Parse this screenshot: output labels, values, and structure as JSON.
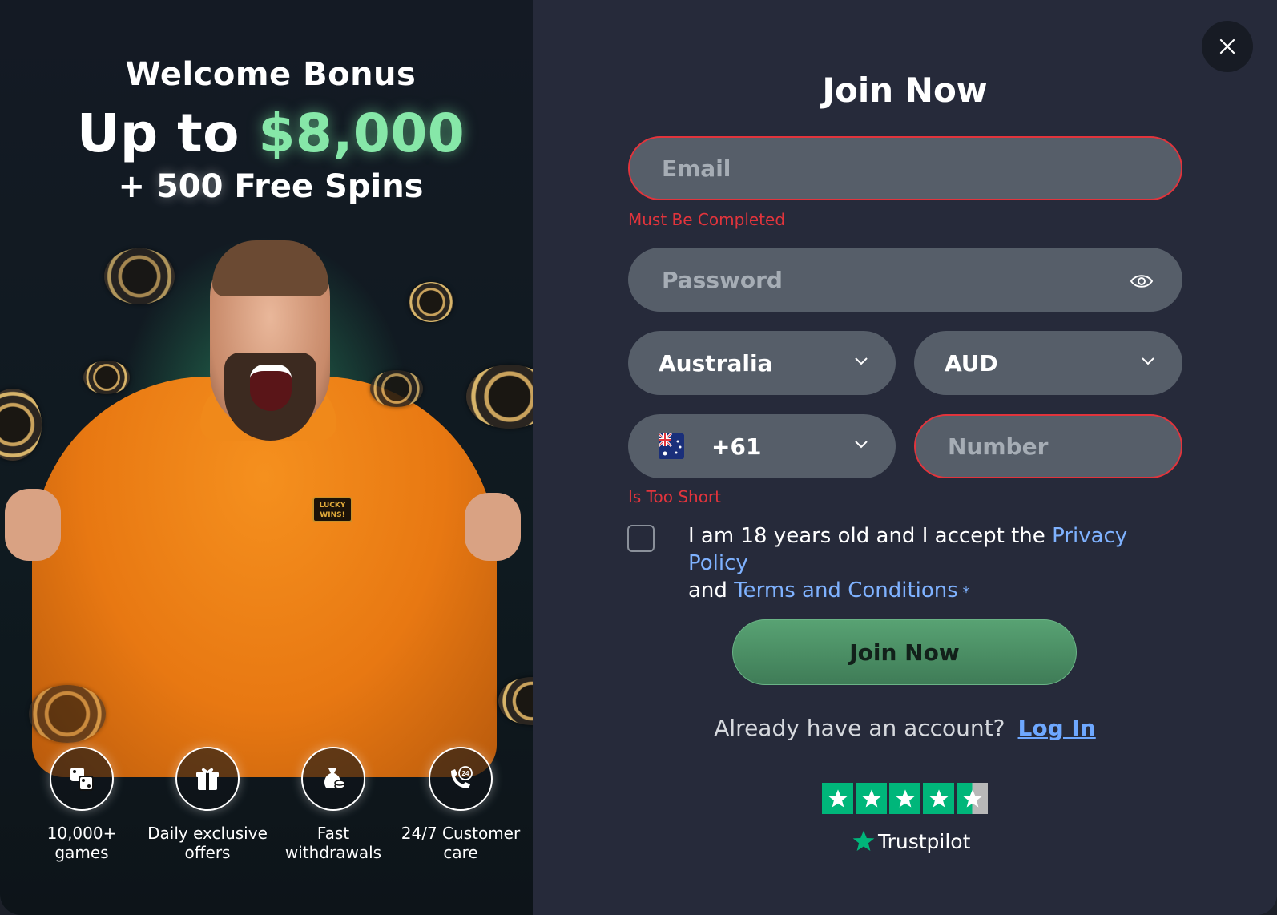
{
  "left": {
    "title": "Welcome Bonus",
    "amount_prefix": "Up to ",
    "amount_value": "$8,000",
    "spins_prefix": "+ ",
    "spins_number": "500",
    "spins_suffix": " Free Spins",
    "patch_text": "LUCKY WINS!",
    "features": [
      {
        "icon": "dice-icon",
        "label": "10,000+ games"
      },
      {
        "icon": "gift-icon",
        "label": "Daily exclusive offers"
      },
      {
        "icon": "money-bag-icon",
        "label": "Fast withdrawals"
      },
      {
        "icon": "phone-24-icon",
        "label": "24/7 Customer care"
      }
    ]
  },
  "form": {
    "title": "Join Now",
    "email_placeholder": "Email",
    "email_error": "Must Be Completed",
    "password_placeholder": "Password",
    "country": "Australia",
    "currency": "AUD",
    "phone_code": "+61",
    "number_placeholder": "Number",
    "number_error": "Is Too Short",
    "consent_text_1": "I am 18 years old and I accept the ",
    "privacy_link": "Privacy Policy",
    "consent_text_2": "and ",
    "terms_link": "Terms and Conditions",
    "required_mark": " *",
    "submit_label": "Join Now",
    "login_prompt": "Already have an account?",
    "login_link": "Log In",
    "trustpilot_label": "Trustpilot",
    "trustpilot_rating_stars": 4.5
  },
  "colors": {
    "accent_green": "#86e7a8",
    "error_red": "#e2343c",
    "link_blue": "#7fb2ff",
    "trustpilot_green": "#00b67a"
  }
}
